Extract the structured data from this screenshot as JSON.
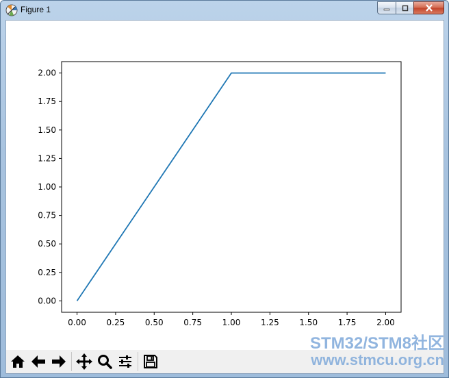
{
  "window": {
    "title": "Figure 1",
    "icons": {
      "app": "matplotlib-icon",
      "minimize": "minimize-icon",
      "maximize": "maximize-icon",
      "close": "close-icon"
    }
  },
  "chart_data": {
    "type": "line",
    "title": "",
    "xlabel": "",
    "ylabel": "",
    "xlim": [
      -0.1,
      2.1
    ],
    "ylim": [
      -0.1,
      2.1
    ],
    "x_ticks": [
      "0.00",
      "0.25",
      "0.50",
      "0.75",
      "1.00",
      "1.25",
      "1.50",
      "1.75",
      "2.00"
    ],
    "y_ticks": [
      "0.00",
      "0.25",
      "0.50",
      "0.75",
      "1.00",
      "1.25",
      "1.50",
      "1.75",
      "2.00"
    ],
    "grid": false,
    "line_color": "#1f77b4",
    "series": [
      {
        "x": [
          0.0,
          1.0,
          2.0
        ],
        "y": [
          0.0,
          2.0,
          2.0
        ]
      }
    ]
  },
  "toolbar": {
    "buttons": [
      "home-icon",
      "back-icon",
      "forward-icon",
      "pan-icon",
      "zoom-icon",
      "configure-subplots-icon",
      "save-icon"
    ]
  },
  "watermark": {
    "line1": "STM32/STM8社区",
    "line2": "www.stmcu.org.cn"
  }
}
